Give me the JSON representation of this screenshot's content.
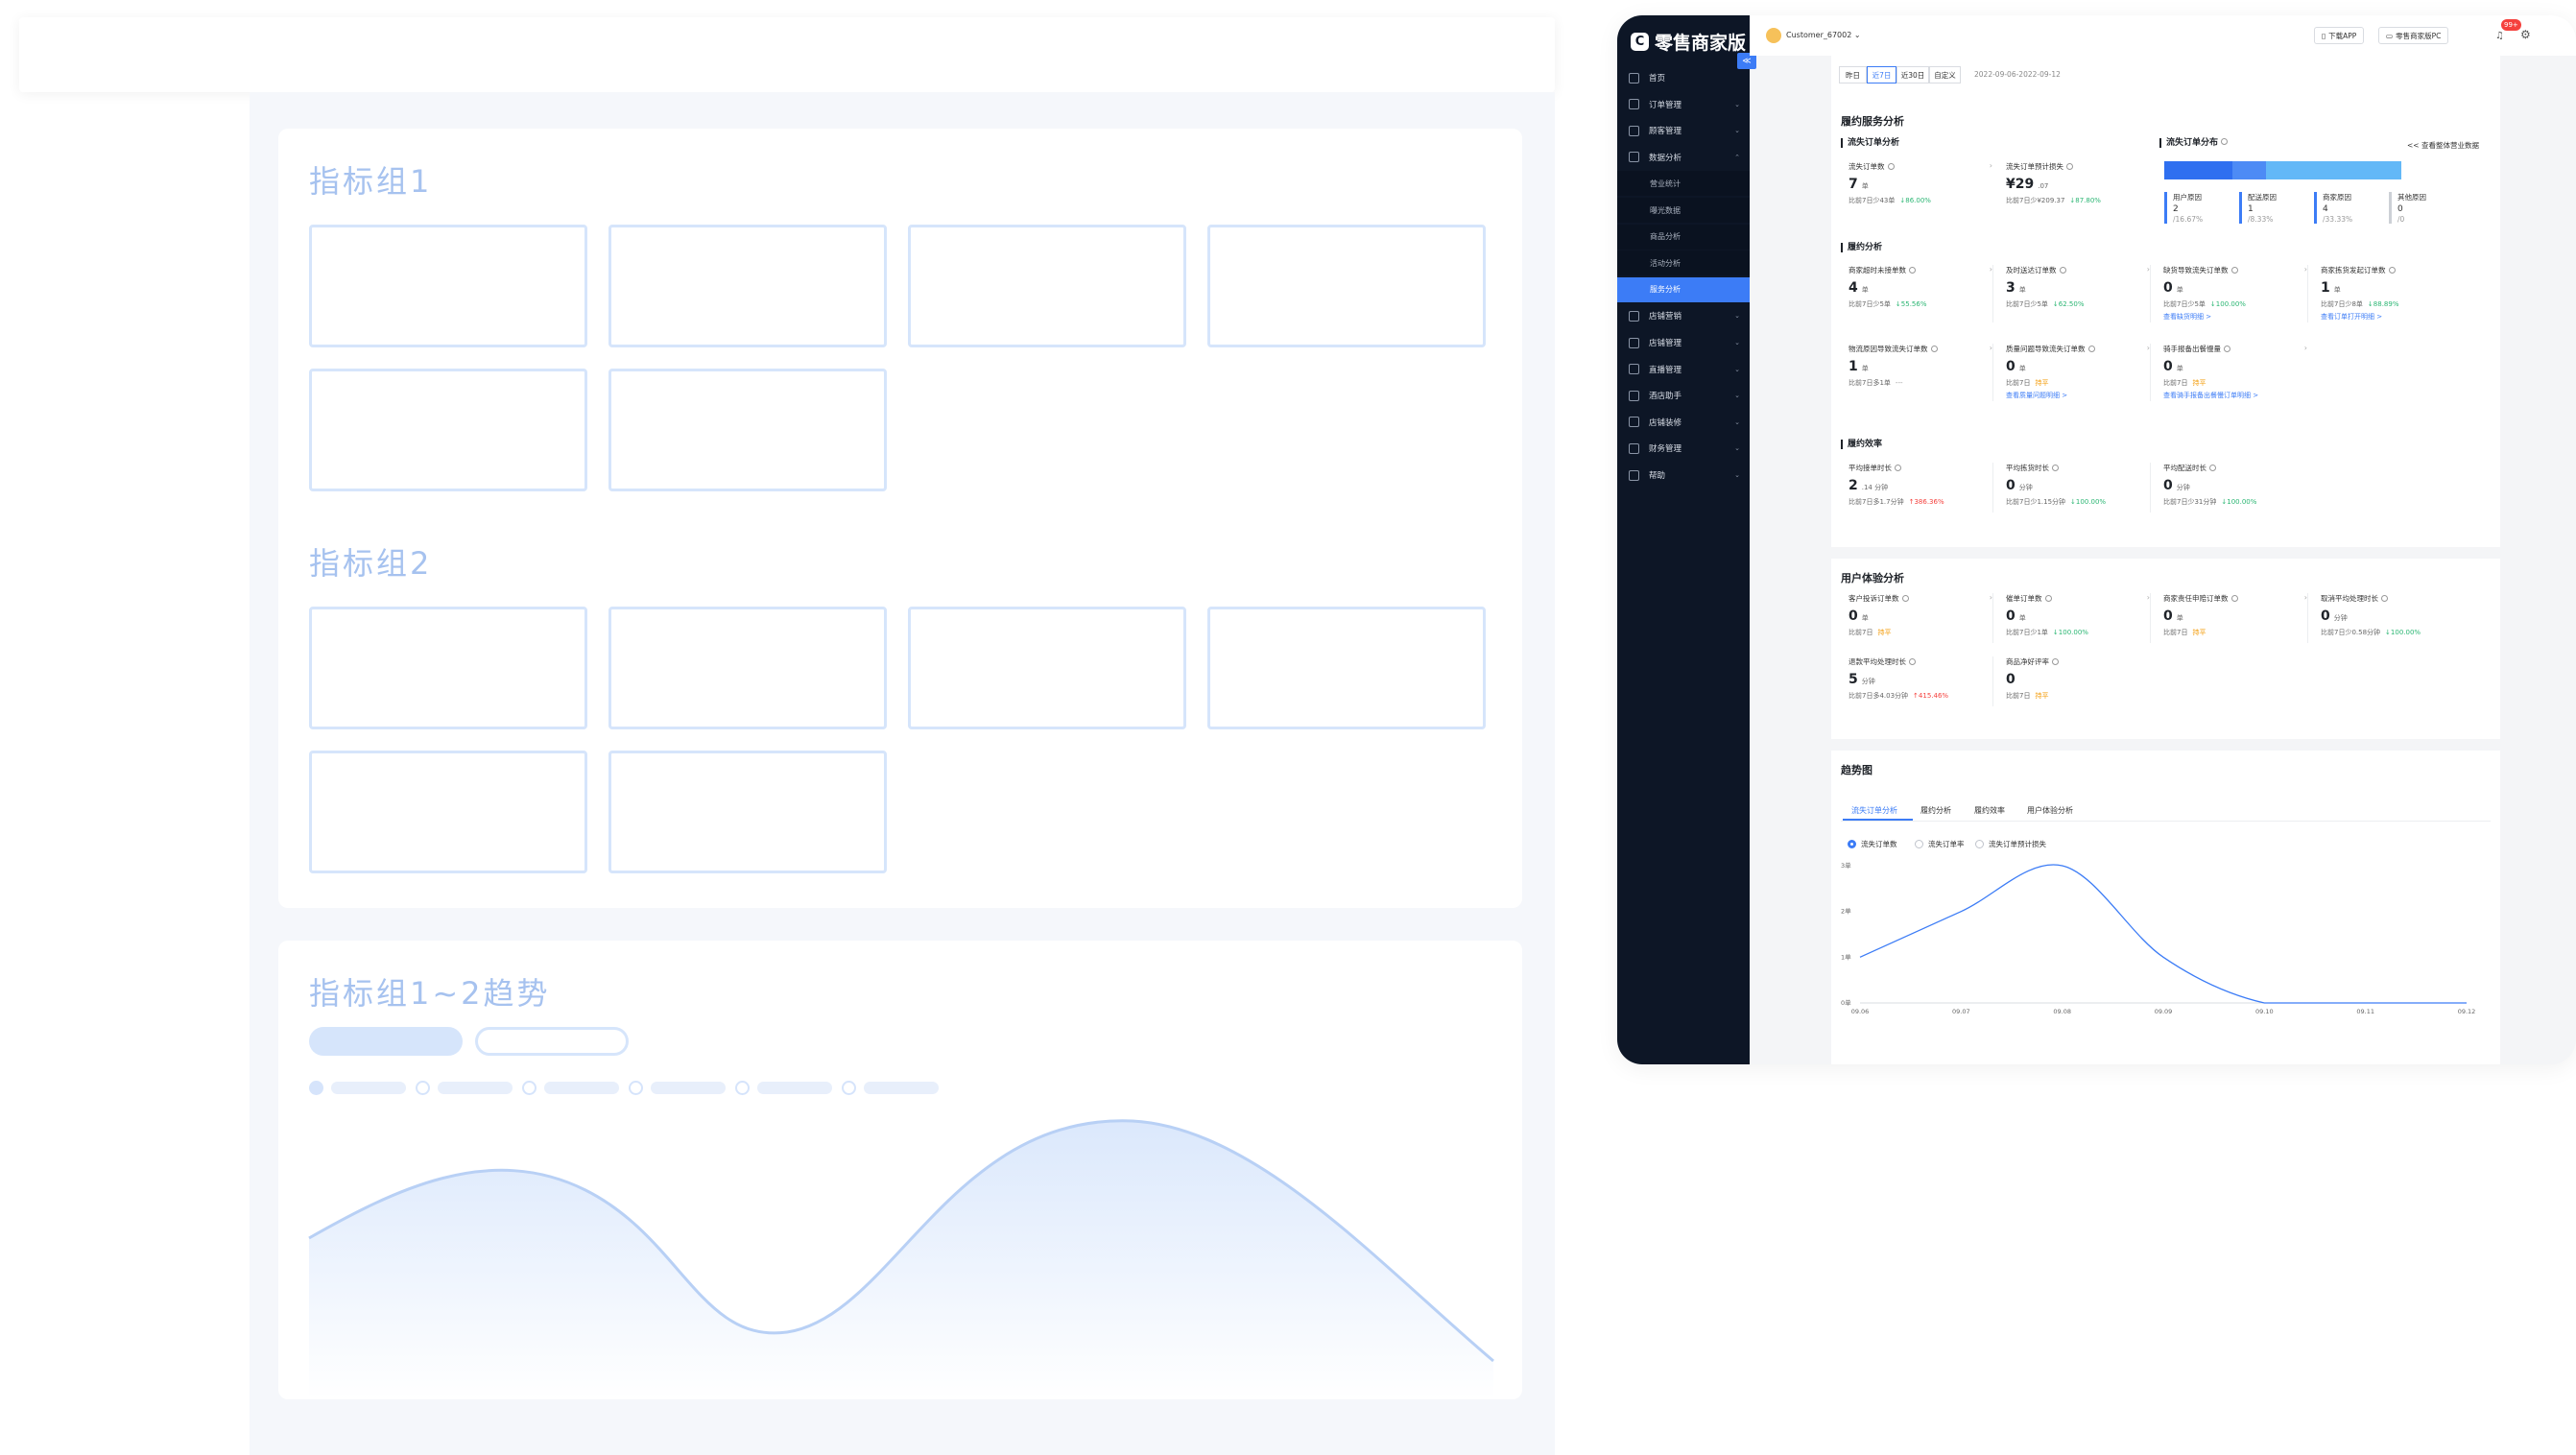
{
  "wireframe": {
    "group1_title": "指标组1",
    "group2_title": "指标组2",
    "trend_title": "指标组1~2趋势"
  },
  "app": {
    "logo_text": "零售商家版",
    "logo_icon": "logo-c-icon",
    "user_name": "Customer_67002",
    "download_app": "下载APP",
    "pc_label": "零售商家版PC",
    "notification_badge": "99+",
    "collapse_glyph": "≪",
    "menu": [
      {
        "label": "首页",
        "icon": "home-icon",
        "chev": ""
      },
      {
        "label": "订单管理",
        "icon": "order-icon",
        "chev": "⌄"
      },
      {
        "label": "顾客管理",
        "icon": "customer-icon",
        "chev": "⌄"
      },
      {
        "label": "数据分析",
        "icon": "data-icon",
        "chev": "⌃"
      }
    ],
    "submenu": [
      "营业统计",
      "曝光数据",
      "商品分析",
      "活动分析",
      "服务分析"
    ],
    "submenu_active": "服务分析",
    "menu2": [
      {
        "label": "店铺营销",
        "icon": "marketing-icon",
        "chev": "⌄"
      },
      {
        "label": "店铺管理",
        "icon": "store-icon",
        "chev": "⌄"
      },
      {
        "label": "直播管理",
        "icon": "live-icon",
        "chev": "⌄"
      },
      {
        "label": "酒店助手",
        "icon": "hotel-icon",
        "chev": "⌄"
      },
      {
        "label": "店铺装修",
        "icon": "decor-icon",
        "chev": "⌄"
      },
      {
        "label": "财务管理",
        "icon": "finance-icon",
        "chev": "⌄"
      },
      {
        "label": "帮助",
        "icon": "help-icon",
        "chev": "⌄"
      }
    ],
    "date_tabs": [
      "昨日",
      "近7日",
      "近30日",
      "自定义"
    ],
    "date_tab_active": "近7日",
    "date_range": "2022-09-06-2022-09-12",
    "fulfill_title": "履约服务分析",
    "lost_section": "流失订单分析",
    "lost_count": {
      "label": "流失订单数",
      "value": "7",
      "unit": "单",
      "cmp": "比前7日少43单",
      "chg": "↓86.00%"
    },
    "lost_loss": {
      "label": "流失订单预计损失",
      "value": "¥29",
      "unit": ".07",
      "cmp": "比前7日少¥209.37",
      "chg": "↓87.80%"
    },
    "dist_title": "流失订单分布",
    "dist_link": "<< 查看整体营业数据",
    "dist_segments": [
      {
        "share": 28.57,
        "color": "#2f6ff0"
      },
      {
        "share": 14.29,
        "color": "#4d8bf5"
      },
      {
        "share": 57.14,
        "color": "#63b8f7"
      }
    ],
    "dist_cols": [
      {
        "name": "用户原因",
        "count": "2",
        "pct": "/16.67%"
      },
      {
        "name": "配送原因",
        "count": "1",
        "pct": "/8.33%"
      },
      {
        "name": "商家原因",
        "count": "4",
        "pct": "/33.33%"
      },
      {
        "name": "其他原因",
        "count": "0",
        "pct": "/0"
      }
    ],
    "perf_title": "履约分析",
    "perf": [
      {
        "label": "商家超时未接单数",
        "value": "4",
        "unit": "单",
        "cmp": "比前7日少5单",
        "chg": "↓55.56%",
        "chg_color": "green",
        "link": ""
      },
      {
        "label": "及时送达订单数",
        "value": "3",
        "unit": "单",
        "cmp": "比前7日少5单",
        "chg": "↓62.50%",
        "chg_color": "green",
        "link": ""
      },
      {
        "label": "缺货导致流失订单数",
        "value": "0",
        "unit": "单",
        "cmp": "比前7日少5单",
        "chg": "↓100.00%",
        "chg_color": "green",
        "link": "查看缺货明细 >"
      },
      {
        "label": "商家拣货发起订单数",
        "value": "1",
        "unit": "单",
        "cmp": "比前7日少8单",
        "chg": "↓88.89%",
        "chg_color": "green",
        "link": "查看订单打开明细 >"
      },
      {
        "label": "物流原因导致流失订单数",
        "value": "1",
        "unit": "单",
        "cmp": "比前7日多1单",
        "chg": "---",
        "chg_color": "gray",
        "link": ""
      },
      {
        "label": "质量问题导致流失订单数",
        "value": "0",
        "unit": "单",
        "cmp": "比前7日",
        "chg": "持平",
        "chg_color": "orange",
        "link": "查看质量问题明细 >"
      },
      {
        "label": "骑手报备出餐慢量",
        "value": "0",
        "unit": "单",
        "cmp": "比前7日",
        "chg": "持平",
        "chg_color": "orange",
        "link": "查看骑手报备出餐慢订单明细 >"
      }
    ],
    "eff_title": "履约效率",
    "eff": [
      {
        "label": "平均接单时长",
        "value": "2",
        "unit": ".14 分钟",
        "cmp": "比前7日多1.7分钟",
        "chg": "↑386.36%",
        "chg_color": "red"
      },
      {
        "label": "平均拣货时长",
        "value": "0",
        "unit": "分钟",
        "cmp": "比前7日少1.15分钟",
        "chg": "↓100.00%",
        "chg_color": "green"
      },
      {
        "label": "平均配送时长",
        "value": "0",
        "unit": "分钟",
        "cmp": "比前7日少31分钟",
        "chg": "↓100.00%",
        "chg_color": "green"
      }
    ],
    "ux_title": "用户体验分析",
    "ux": [
      {
        "label": "客户投诉订单数",
        "value": "0",
        "unit": "单",
        "cmp": "比前7日",
        "chg": "持平",
        "chg_color": "orange"
      },
      {
        "label": "催单订单数",
        "value": "0",
        "unit": "单",
        "cmp": "比前7日少1单",
        "chg": "↓100.00%",
        "chg_color": "green"
      },
      {
        "label": "商家责任申赔订单数",
        "value": "0",
        "unit": "单",
        "cmp": "比前7日",
        "chg": "持平",
        "chg_color": "orange"
      },
      {
        "label": "取消平均处理时长",
        "value": "0",
        "unit": "分钟",
        "cmp": "比前7日少0.58分钟",
        "chg": "↓100.00%",
        "chg_color": "green"
      },
      {
        "label": "退款平均处理时长",
        "value": "5",
        "unit": "分钟",
        "cmp": "比前7日多4.03分钟",
        "chg": "↑415.46%",
        "chg_color": "red"
      },
      {
        "label": "商品净好评率",
        "value": "0",
        "unit": "",
        "cmp": "比前7日",
        "chg": "持平",
        "chg_color": "orange"
      }
    ],
    "trend_title": "趋势图",
    "trend_tabs": [
      "流失订单分析",
      "履约分析",
      "履约效率",
      "用户体验分析"
    ],
    "trend_tab_active": "流失订单分析",
    "trend_radios": [
      "流失订单数",
      "流失订单率",
      "流失订单预计损失"
    ],
    "trend_radio_active": "流失订单数"
  },
  "chart_data": {
    "type": "line",
    "x": [
      "09.06",
      "09.07",
      "09.08",
      "09.09",
      "09.10",
      "09.11",
      "09.12"
    ],
    "y_ticks": [
      "0单",
      "1单",
      "2单",
      "3单"
    ],
    "values": [
      1,
      2,
      3,
      1,
      0,
      0,
      0
    ],
    "ylim": [
      0,
      3
    ],
    "xlabel": "",
    "ylabel": ""
  }
}
